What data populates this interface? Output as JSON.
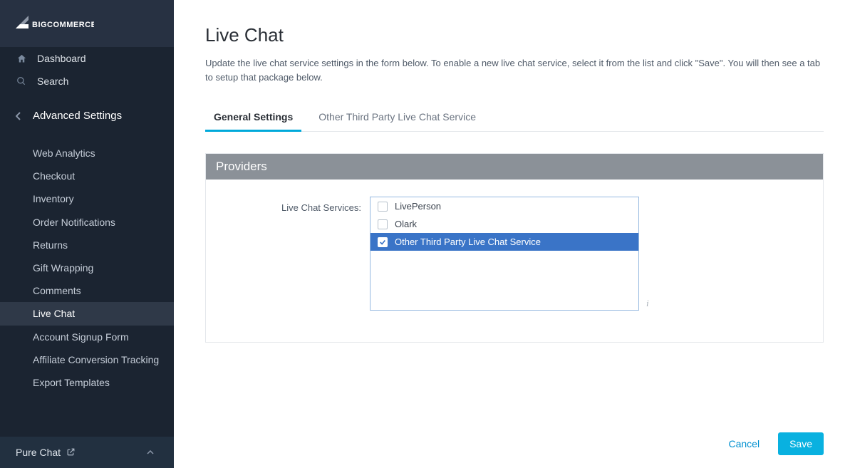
{
  "brand": "BIGCOMMERCE",
  "nav": {
    "dashboard": "Dashboard",
    "search": "Search"
  },
  "section": {
    "title": "Advanced Settings",
    "items": [
      "Web Analytics",
      "Checkout",
      "Inventory",
      "Order Notifications",
      "Returns",
      "Gift Wrapping",
      "Comments",
      "Live Chat",
      "Account Signup Form",
      "Affiliate Conversion Tracking",
      "Export Templates"
    ],
    "activeIndex": 7
  },
  "footer": {
    "label": "Pure Chat"
  },
  "page": {
    "title": "Live Chat",
    "description": "Update the live chat service settings in the form below. To enable a new live chat service, select it from the list and click \"Save\". You will then see a tab to setup that package below."
  },
  "tabs": [
    {
      "label": "General Settings",
      "active": true
    },
    {
      "label": "Other Third Party Live Chat Service",
      "active": false
    }
  ],
  "panel": {
    "header": "Providers",
    "fieldLabel": "Live Chat Services:",
    "options": [
      {
        "label": "LivePerson",
        "checked": false
      },
      {
        "label": "Olark",
        "checked": false
      },
      {
        "label": "Other Third Party Live Chat Service",
        "checked": true
      }
    ]
  },
  "actions": {
    "cancel": "Cancel",
    "save": "Save"
  }
}
